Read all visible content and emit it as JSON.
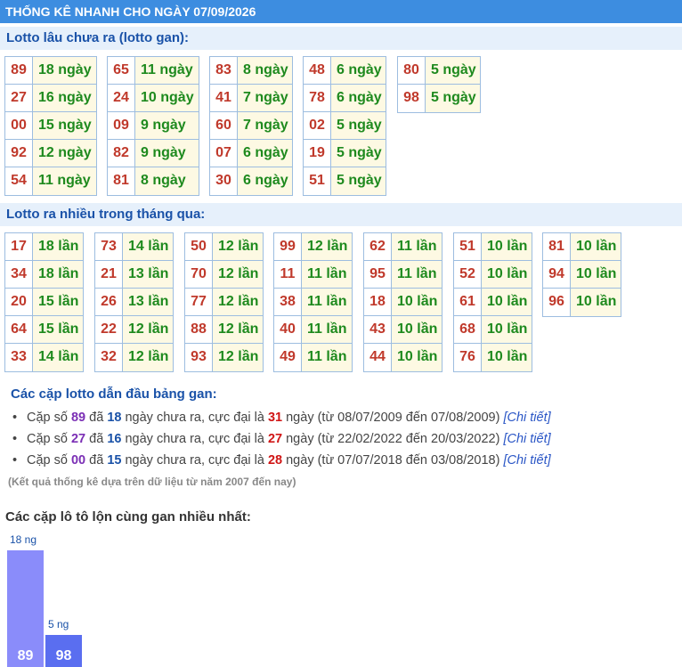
{
  "header": {
    "title": "THỐNG KÊ NHANH CHO NGÀY 07/09/2026"
  },
  "gan_section": {
    "title": "Lotto lâu chưa ra (lotto gan):",
    "groups": [
      [
        {
          "num": "89",
          "val": "18 ngày"
        },
        {
          "num": "27",
          "val": "16 ngày"
        },
        {
          "num": "00",
          "val": "15 ngày"
        },
        {
          "num": "92",
          "val": "12 ngày"
        },
        {
          "num": "54",
          "val": "11 ngày"
        }
      ],
      [
        {
          "num": "65",
          "val": "11 ngày"
        },
        {
          "num": "24",
          "val": "10 ngày"
        },
        {
          "num": "09",
          "val": "9 ngày"
        },
        {
          "num": "82",
          "val": "9 ngày"
        },
        {
          "num": "81",
          "val": "8 ngày"
        }
      ],
      [
        {
          "num": "83",
          "val": "8 ngày"
        },
        {
          "num": "41",
          "val": "7 ngày"
        },
        {
          "num": "60",
          "val": "7 ngày"
        },
        {
          "num": "07",
          "val": "6 ngày"
        },
        {
          "num": "30",
          "val": "6 ngày"
        }
      ],
      [
        {
          "num": "48",
          "val": "6 ngày"
        },
        {
          "num": "78",
          "val": "6 ngày"
        },
        {
          "num": "02",
          "val": "5 ngày"
        },
        {
          "num": "19",
          "val": "5 ngày"
        },
        {
          "num": "51",
          "val": "5 ngày"
        }
      ],
      [
        {
          "num": "80",
          "val": "5 ngày"
        },
        {
          "num": "98",
          "val": "5 ngày"
        }
      ]
    ]
  },
  "freq_section": {
    "title": "Lotto ra nhiều trong tháng qua:",
    "groups": [
      [
        {
          "num": "17",
          "val": "18 lần"
        },
        {
          "num": "34",
          "val": "18 lần"
        },
        {
          "num": "20",
          "val": "15 lần"
        },
        {
          "num": "64",
          "val": "15 lần"
        },
        {
          "num": "33",
          "val": "14 lần"
        }
      ],
      [
        {
          "num": "73",
          "val": "14 lần"
        },
        {
          "num": "21",
          "val": "13 lần"
        },
        {
          "num": "26",
          "val": "13 lần"
        },
        {
          "num": "22",
          "val": "12 lần"
        },
        {
          "num": "32",
          "val": "12 lần"
        }
      ],
      [
        {
          "num": "50",
          "val": "12 lần"
        },
        {
          "num": "70",
          "val": "12 lần"
        },
        {
          "num": "77",
          "val": "12 lần"
        },
        {
          "num": "88",
          "val": "12 lần"
        },
        {
          "num": "93",
          "val": "12 lần"
        }
      ],
      [
        {
          "num": "99",
          "val": "12 lần"
        },
        {
          "num": "11",
          "val": "11 lần"
        },
        {
          "num": "38",
          "val": "11 lần"
        },
        {
          "num": "40",
          "val": "11 lần"
        },
        {
          "num": "49",
          "val": "11 lần"
        }
      ],
      [
        {
          "num": "62",
          "val": "11 lần"
        },
        {
          "num": "95",
          "val": "11 lần"
        },
        {
          "num": "18",
          "val": "10 lần"
        },
        {
          "num": "43",
          "val": "10 lần"
        },
        {
          "num": "44",
          "val": "10 lần"
        }
      ],
      [
        {
          "num": "51",
          "val": "10 lần"
        },
        {
          "num": "52",
          "val": "10 lần"
        },
        {
          "num": "61",
          "val": "10 lần"
        },
        {
          "num": "68",
          "val": "10 lần"
        },
        {
          "num": "76",
          "val": "10 lần"
        }
      ],
      [
        {
          "num": "81",
          "val": "10 lần"
        },
        {
          "num": "94",
          "val": "10 lần"
        },
        {
          "num": "96",
          "val": "10 lần"
        }
      ]
    ]
  },
  "pairs": {
    "title": "Các cặp lotto dẫn đầu bảng gan:",
    "items": [
      {
        "pre": "Cặp số ",
        "num": "89",
        "mid1": " đã ",
        "days": "18",
        "mid2": " ngày chưa ra, cực đại là ",
        "max": "31",
        "post": " ngày (từ 08/07/2009 đến 07/08/2009) ",
        "link": "[Chi tiết]"
      },
      {
        "pre": "Cặp số ",
        "num": "27",
        "mid1": " đã ",
        "days": "16",
        "mid2": " ngày chưa ra, cực đại là ",
        "max": "27",
        "post": " ngày (từ 22/02/2022 đến 20/03/2022) ",
        "link": "[Chi tiết]"
      },
      {
        "pre": "Cặp số ",
        "num": "00",
        "mid1": " đã ",
        "days": "15",
        "mid2": " ngày chưa ra, cực đại là ",
        "max": "28",
        "post": " ngày (từ 07/07/2018 đến 03/08/2018) ",
        "link": "[Chi tiết]"
      }
    ],
    "note": "(Kết quả thống kê dựa trên dữ liệu từ năm 2007 đến nay)"
  },
  "chart_data": {
    "type": "bar",
    "title": "Các cặp lô tô lộn cùng gan nhiều nhất:",
    "categories": [
      "89",
      "98"
    ],
    "values": [
      18,
      5
    ],
    "value_labels": [
      "18 ng",
      "5 ng"
    ],
    "colors": [
      "#8a8cfa",
      "#5a6ef0"
    ]
  },
  "colors": {
    "header_bg": "#3d8de0",
    "section_bg": "#e6f0fb",
    "number": "#c0392b",
    "count": "#1e8a1e",
    "cell_bg": "#fdf9e3"
  }
}
